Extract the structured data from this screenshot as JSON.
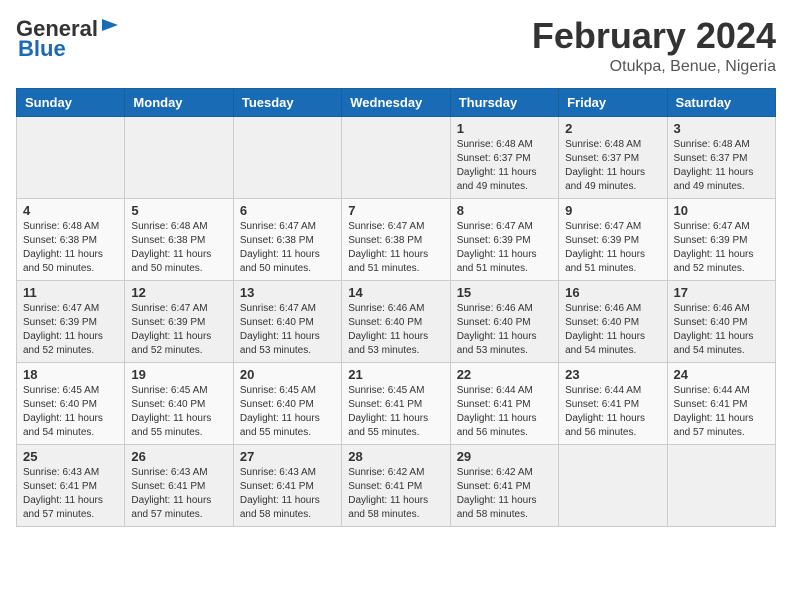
{
  "header": {
    "logo": {
      "general": "General",
      "blue": "Blue"
    },
    "title": "February 2024",
    "subtitle": "Otukpa, Benue, Nigeria"
  },
  "weekdays": [
    "Sunday",
    "Monday",
    "Tuesday",
    "Wednesday",
    "Thursday",
    "Friday",
    "Saturday"
  ],
  "weeks": [
    [
      {
        "day": "",
        "info": ""
      },
      {
        "day": "",
        "info": ""
      },
      {
        "day": "",
        "info": ""
      },
      {
        "day": "",
        "info": ""
      },
      {
        "day": "1",
        "info": "Sunrise: 6:48 AM\nSunset: 6:37 PM\nDaylight: 11 hours and 49 minutes."
      },
      {
        "day": "2",
        "info": "Sunrise: 6:48 AM\nSunset: 6:37 PM\nDaylight: 11 hours and 49 minutes."
      },
      {
        "day": "3",
        "info": "Sunrise: 6:48 AM\nSunset: 6:37 PM\nDaylight: 11 hours and 49 minutes."
      }
    ],
    [
      {
        "day": "4",
        "info": "Sunrise: 6:48 AM\nSunset: 6:38 PM\nDaylight: 11 hours and 50 minutes."
      },
      {
        "day": "5",
        "info": "Sunrise: 6:48 AM\nSunset: 6:38 PM\nDaylight: 11 hours and 50 minutes."
      },
      {
        "day": "6",
        "info": "Sunrise: 6:47 AM\nSunset: 6:38 PM\nDaylight: 11 hours and 50 minutes."
      },
      {
        "day": "7",
        "info": "Sunrise: 6:47 AM\nSunset: 6:38 PM\nDaylight: 11 hours and 51 minutes."
      },
      {
        "day": "8",
        "info": "Sunrise: 6:47 AM\nSunset: 6:39 PM\nDaylight: 11 hours and 51 minutes."
      },
      {
        "day": "9",
        "info": "Sunrise: 6:47 AM\nSunset: 6:39 PM\nDaylight: 11 hours and 51 minutes."
      },
      {
        "day": "10",
        "info": "Sunrise: 6:47 AM\nSunset: 6:39 PM\nDaylight: 11 hours and 52 minutes."
      }
    ],
    [
      {
        "day": "11",
        "info": "Sunrise: 6:47 AM\nSunset: 6:39 PM\nDaylight: 11 hours and 52 minutes."
      },
      {
        "day": "12",
        "info": "Sunrise: 6:47 AM\nSunset: 6:39 PM\nDaylight: 11 hours and 52 minutes."
      },
      {
        "day": "13",
        "info": "Sunrise: 6:47 AM\nSunset: 6:40 PM\nDaylight: 11 hours and 53 minutes."
      },
      {
        "day": "14",
        "info": "Sunrise: 6:46 AM\nSunset: 6:40 PM\nDaylight: 11 hours and 53 minutes."
      },
      {
        "day": "15",
        "info": "Sunrise: 6:46 AM\nSunset: 6:40 PM\nDaylight: 11 hours and 53 minutes."
      },
      {
        "day": "16",
        "info": "Sunrise: 6:46 AM\nSunset: 6:40 PM\nDaylight: 11 hours and 54 minutes."
      },
      {
        "day": "17",
        "info": "Sunrise: 6:46 AM\nSunset: 6:40 PM\nDaylight: 11 hours and 54 minutes."
      }
    ],
    [
      {
        "day": "18",
        "info": "Sunrise: 6:45 AM\nSunset: 6:40 PM\nDaylight: 11 hours and 54 minutes."
      },
      {
        "day": "19",
        "info": "Sunrise: 6:45 AM\nSunset: 6:40 PM\nDaylight: 11 hours and 55 minutes."
      },
      {
        "day": "20",
        "info": "Sunrise: 6:45 AM\nSunset: 6:40 PM\nDaylight: 11 hours and 55 minutes."
      },
      {
        "day": "21",
        "info": "Sunrise: 6:45 AM\nSunset: 6:41 PM\nDaylight: 11 hours and 55 minutes."
      },
      {
        "day": "22",
        "info": "Sunrise: 6:44 AM\nSunset: 6:41 PM\nDaylight: 11 hours and 56 minutes."
      },
      {
        "day": "23",
        "info": "Sunrise: 6:44 AM\nSunset: 6:41 PM\nDaylight: 11 hours and 56 minutes."
      },
      {
        "day": "24",
        "info": "Sunrise: 6:44 AM\nSunset: 6:41 PM\nDaylight: 11 hours and 57 minutes."
      }
    ],
    [
      {
        "day": "25",
        "info": "Sunrise: 6:43 AM\nSunset: 6:41 PM\nDaylight: 11 hours and 57 minutes."
      },
      {
        "day": "26",
        "info": "Sunrise: 6:43 AM\nSunset: 6:41 PM\nDaylight: 11 hours and 57 minutes."
      },
      {
        "day": "27",
        "info": "Sunrise: 6:43 AM\nSunset: 6:41 PM\nDaylight: 11 hours and 58 minutes."
      },
      {
        "day": "28",
        "info": "Sunrise: 6:42 AM\nSunset: 6:41 PM\nDaylight: 11 hours and 58 minutes."
      },
      {
        "day": "29",
        "info": "Sunrise: 6:42 AM\nSunset: 6:41 PM\nDaylight: 11 hours and 58 minutes."
      },
      {
        "day": "",
        "info": ""
      },
      {
        "day": "",
        "info": ""
      }
    ]
  ]
}
